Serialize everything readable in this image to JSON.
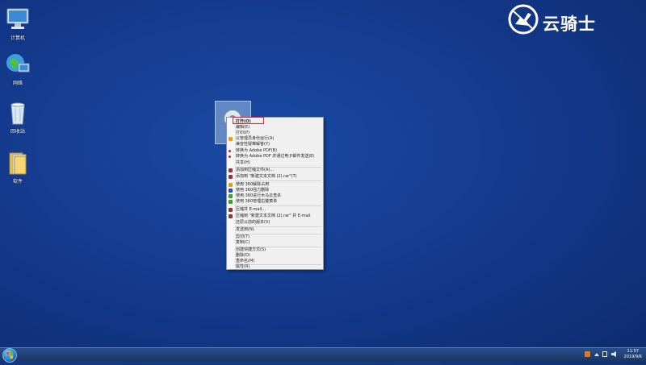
{
  "desktop": {
    "icons": [
      {
        "label": "计算机",
        "icon": "computer-icon"
      },
      {
        "label": "网络",
        "icon": "network-icon"
      },
      {
        "label": "回收站",
        "icon": "recycle-bin-icon"
      },
      {
        "label": "软件",
        "icon": "folder-icon"
      }
    ]
  },
  "watermark": {
    "text": "云骑士"
  },
  "context_menu": {
    "items": [
      {
        "label": "打开(O)",
        "icon": ""
      },
      {
        "label": "编辑(E)",
        "icon": ""
      },
      {
        "label": "打印(P)",
        "icon": ""
      },
      {
        "label": "以管理员身份运行(A)",
        "icon": "shield-icon",
        "color": "#e0a020"
      },
      {
        "label": "兼容性疑难解答(Y)",
        "icon": ""
      },
      {
        "label": "转换为 Adobe PDF(B)",
        "icon": "pdf-icon",
        "color": "#c02020"
      },
      {
        "label": "转换为 Adobe PDF 并通过电子邮件发送(E)",
        "icon": "pdf-icon",
        "color": "#c02020"
      },
      {
        "label": "共享(H)",
        "icon": ""
      },
      {
        "label": "添加到压缩文件(A)...",
        "icon": "archive-icon",
        "color": "#8b3a3a"
      },
      {
        "label": "添加到 \"新建文本文档 (2).rar\"(T)",
        "icon": "archive-icon",
        "color": "#8b3a3a"
      },
      {
        "label": "使用 360解除占用",
        "icon": "360-icon",
        "color": "#d8a020"
      },
      {
        "label": "使用 360强力删除",
        "icon": "360-icon",
        "color": "#2050c0"
      },
      {
        "label": "使用 360进行木马云查杀",
        "icon": "360-icon",
        "color": "#40a020"
      },
      {
        "label": "使用 360管理右键菜单",
        "icon": "360-icon",
        "color": "#40a020"
      },
      {
        "label": "压缩并 E-mail...",
        "icon": "archive-icon",
        "color": "#8b3a3a"
      },
      {
        "label": "压缩到 \"新建文本文档 (2).rar\" 并 E-mail",
        "icon": "archive-icon",
        "color": "#8b3a3a"
      },
      {
        "label": "还原以前的版本(V)",
        "icon": ""
      },
      {
        "label": "发送到(N)",
        "icon": ""
      },
      {
        "label": "剪切(T)",
        "icon": ""
      },
      {
        "label": "复制(C)",
        "icon": ""
      },
      {
        "label": "创建快捷方式(S)",
        "icon": ""
      },
      {
        "label": "删除(D)",
        "icon": ""
      },
      {
        "label": "重命名(M)",
        "icon": ""
      },
      {
        "label": "属性(R)",
        "icon": ""
      }
    ]
  },
  "taskbar": {
    "clock_time": "11:57",
    "clock_date": "2019/9/6"
  },
  "colors": {
    "desktop_bg": "#13388a",
    "highlight_border": "#e02020"
  }
}
